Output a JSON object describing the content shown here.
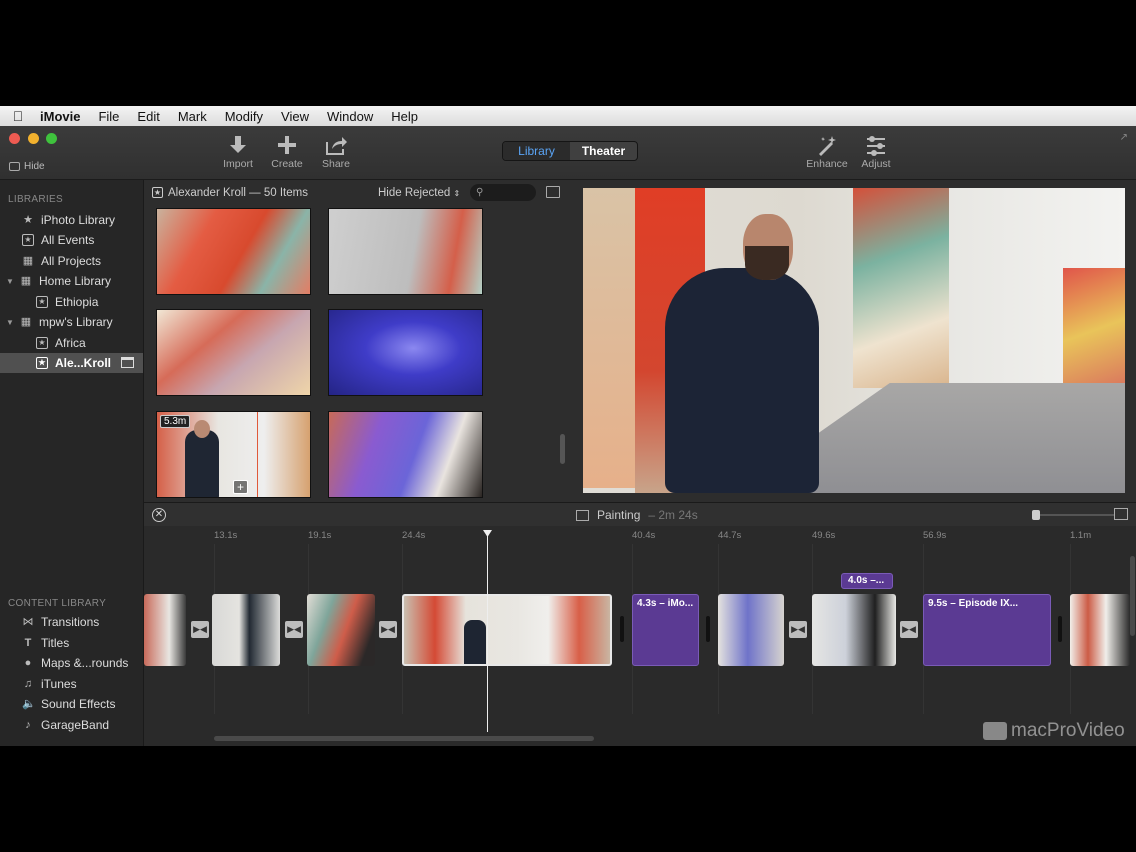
{
  "menubar": {
    "app": "iMovie",
    "items": [
      "File",
      "Edit",
      "Mark",
      "Modify",
      "View",
      "Window",
      "Help"
    ]
  },
  "toolbar": {
    "hide": "Hide",
    "import": "Import",
    "create": "Create",
    "share": "Share",
    "library": "Library",
    "theater": "Theater",
    "enhance": "Enhance",
    "adjust": "Adjust"
  },
  "sidebar": {
    "libraries_header": "LIBRARIES",
    "items": [
      "iPhoto Library",
      "All Events",
      "All Projects",
      "Home Library",
      "Ethiopia",
      "mpw's Library",
      "Africa",
      "Ale...Kroll"
    ],
    "content_header": "CONTENT LIBRARY",
    "content_items": [
      "Transitions",
      "Titles",
      "Maps &...rounds",
      "iTunes",
      "Sound Effects",
      "GarageBand"
    ]
  },
  "browser": {
    "title": "Alexander Kroll — 50 Items",
    "filter": "Hide Rejected",
    "duration_badge": "5.3m"
  },
  "timeline": {
    "project": "Painting",
    "duration": "– 2m 24s",
    "ticks": [
      "13.1s",
      "19.1s",
      "24.4s",
      "40.4s",
      "44.7s",
      "49.6s",
      "56.9s",
      "1.1m"
    ],
    "clips": {
      "title1": "4.3s – iMo...",
      "title2": "9.5s – Episode IX...",
      "bubble": "4.0s –..."
    }
  },
  "watermark": "macProVideo",
  "colors": {
    "accent": "#5aa4f5",
    "title_clip": "#5b3a93"
  }
}
